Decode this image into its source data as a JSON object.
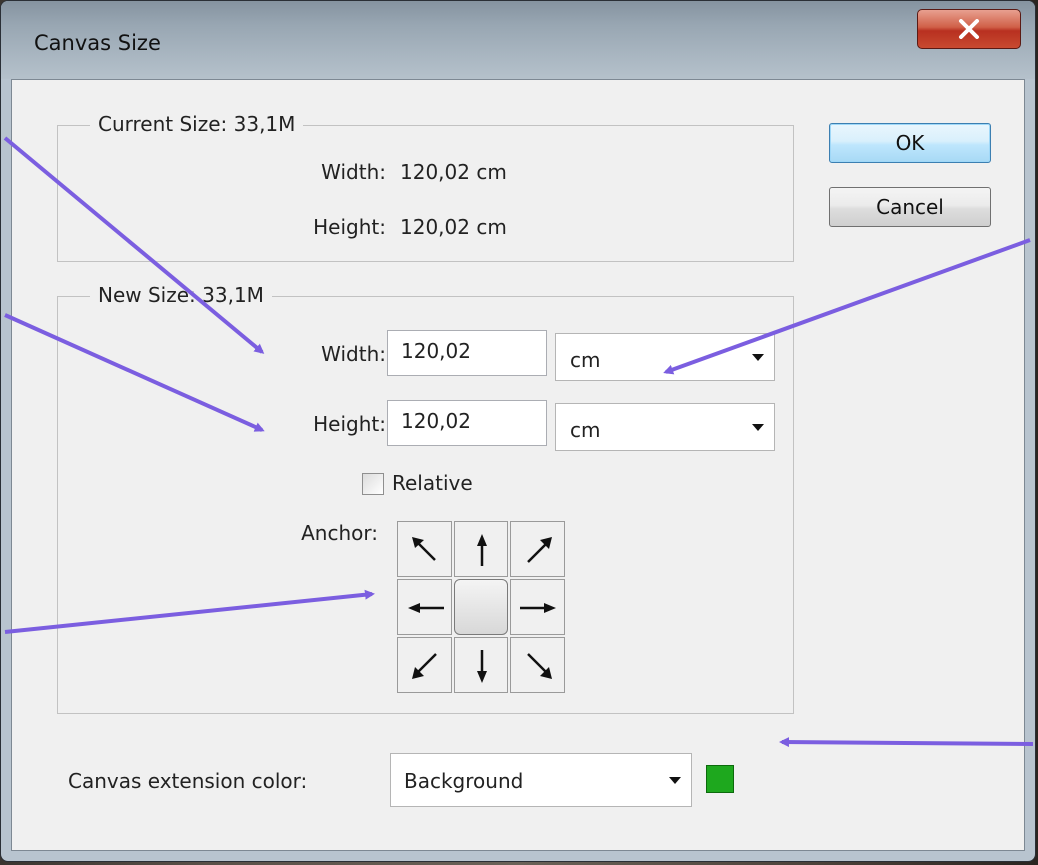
{
  "dialog": {
    "title": "Canvas Size",
    "ok_label": "OK",
    "cancel_label": "Cancel"
  },
  "current_size": {
    "legend": "Current Size: 33,1M",
    "width_label": "Width:",
    "width_value": "120,02 cm",
    "height_label": "Height:",
    "height_value": "120,02 cm"
  },
  "new_size": {
    "legend": "New Size: 33,1M",
    "width_label": "Width:",
    "width_value": "120,02",
    "width_unit": "cm",
    "height_label": "Height:",
    "height_value": "120,02",
    "height_unit": "cm",
    "relative_label": "Relative",
    "relative_checked": false,
    "anchor_label": "Anchor:"
  },
  "extension": {
    "label": "Canvas extension color:",
    "value": "Background",
    "swatch_color": "#1ea81e"
  },
  "colors": {
    "annotation_arrow": "#7b5ee0"
  }
}
